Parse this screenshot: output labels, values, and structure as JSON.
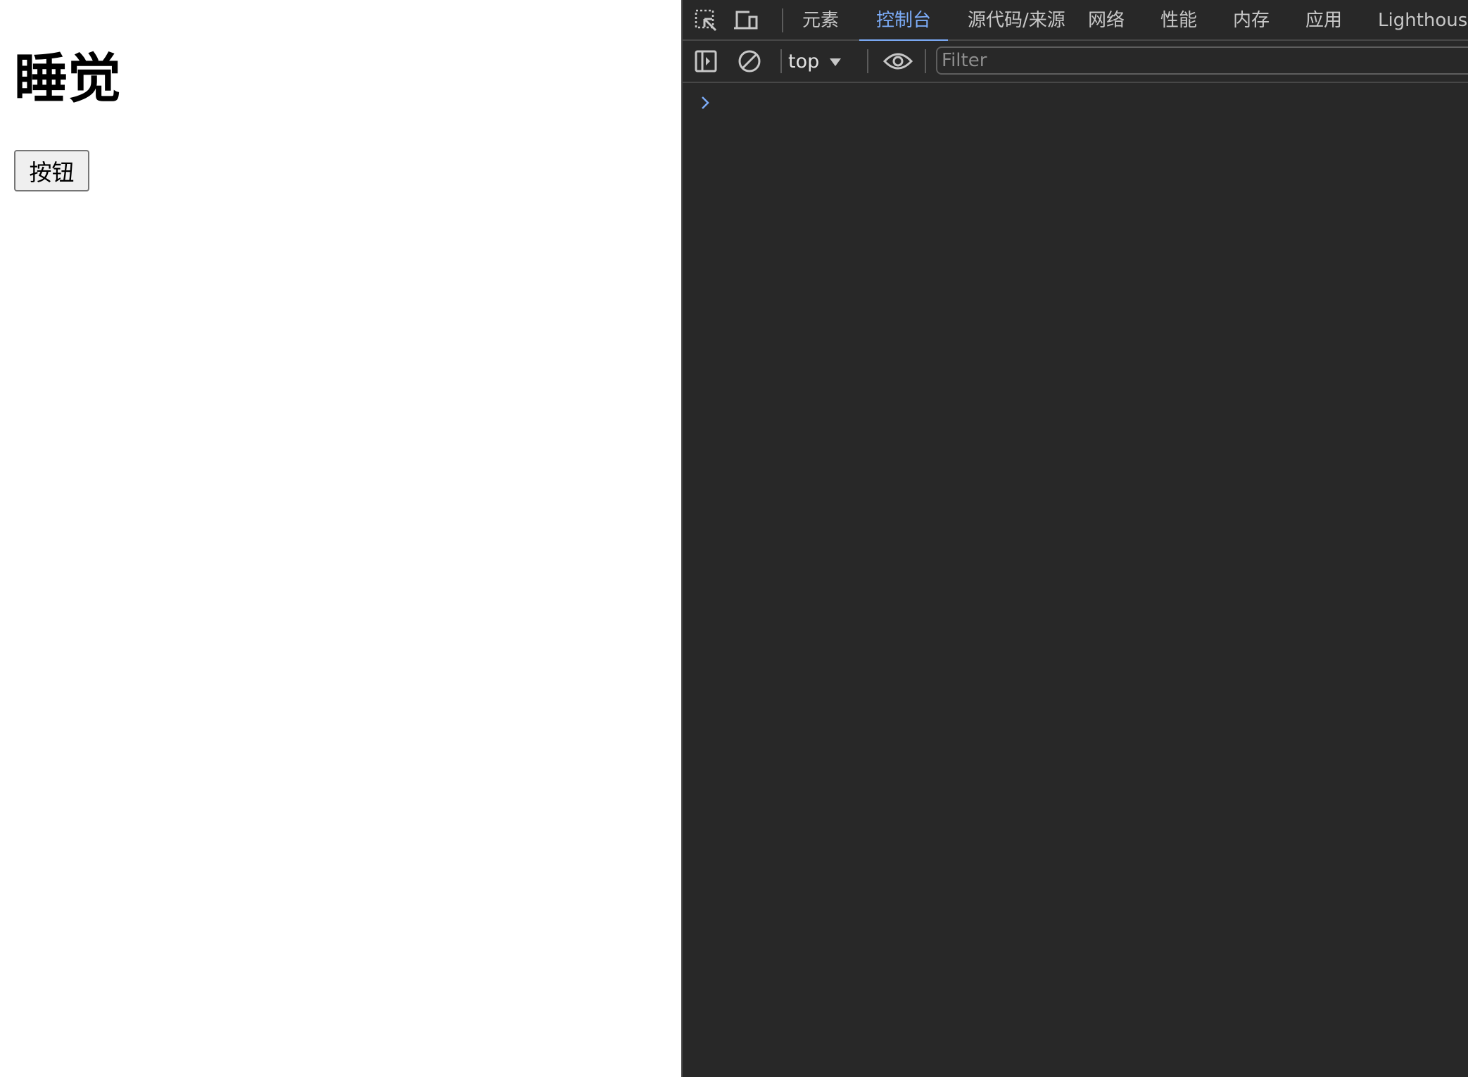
{
  "page": {
    "heading": "睡觉",
    "button_label": "按钮"
  },
  "devtools": {
    "toolbar_icons": [
      "inspect-element-icon",
      "device-toolbar-icon"
    ],
    "tabs": [
      {
        "label": "元素",
        "active": false
      },
      {
        "label": "控制台",
        "active": true
      },
      {
        "label": "源代码/来源",
        "active": false
      },
      {
        "label": "网络",
        "active": false
      },
      {
        "label": "性能",
        "active": false
      },
      {
        "label": "内存",
        "active": false
      },
      {
        "label": "应用",
        "active": false
      },
      {
        "label": "Lighthouse",
        "active": false
      }
    ],
    "console_toolbar": {
      "icons": [
        "sidebar-toggle-icon",
        "clear-console-icon",
        "eye-icon"
      ],
      "context": "top",
      "filter_placeholder": "Filter",
      "filter_value": ""
    },
    "console": {
      "prompt_icon": "chevron-right-icon"
    },
    "colors": {
      "background": "#282828",
      "border": "#474747",
      "tab_text": "#c7c7c7",
      "active_tab": "#7cacf8",
      "prompt": "#7cacf8"
    }
  }
}
